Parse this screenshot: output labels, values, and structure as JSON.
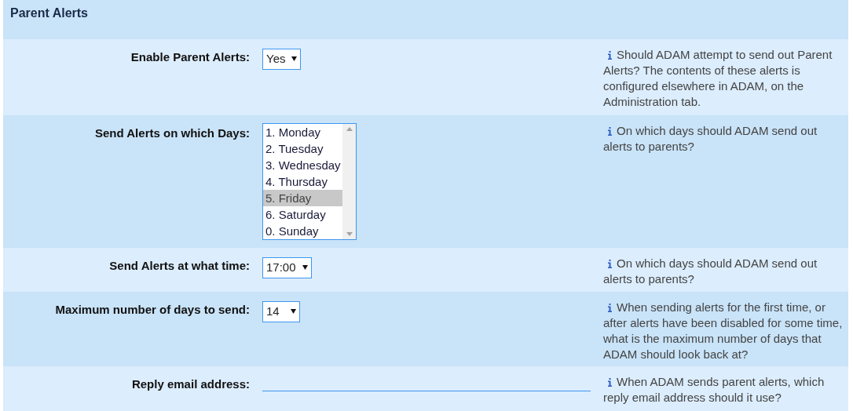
{
  "section": {
    "title": "Parent Alerts"
  },
  "rows": [
    {
      "kind": "select",
      "label": "Enable Parent Alerts:",
      "value": "Yes",
      "help": "Should ADAM attempt to send out Parent Alerts? The contents of these alerts is configured elsewhere in ADAM, on the Administration tab."
    },
    {
      "kind": "listbox",
      "label": "Send Alerts on which Days:",
      "options": [
        {
          "label": "1. Monday",
          "selected": false
        },
        {
          "label": "2. Tuesday",
          "selected": false
        },
        {
          "label": "3. Wednesday",
          "selected": false
        },
        {
          "label": "4. Thursday",
          "selected": false
        },
        {
          "label": "5. Friday",
          "selected": true
        },
        {
          "label": "6. Saturday",
          "selected": false
        },
        {
          "label": "0. Sunday",
          "selected": false
        }
      ],
      "help": "On which days should ADAM send out alerts to parents?"
    },
    {
      "kind": "select",
      "label": "Send Alerts at what time:",
      "value": "17:00",
      "help": "On which days should ADAM send out alerts to parents?"
    },
    {
      "kind": "select",
      "label": "Maximum number of days to send:",
      "value": "14",
      "help": "When sending alerts for the first time, or after alerts have been disabled for some time, what is the maximum number of days that ADAM should look back at?"
    },
    {
      "kind": "text",
      "label": "Reply email address:",
      "help": "When ADAM sends parent alerts, which reply email address should it use?"
    }
  ]
}
